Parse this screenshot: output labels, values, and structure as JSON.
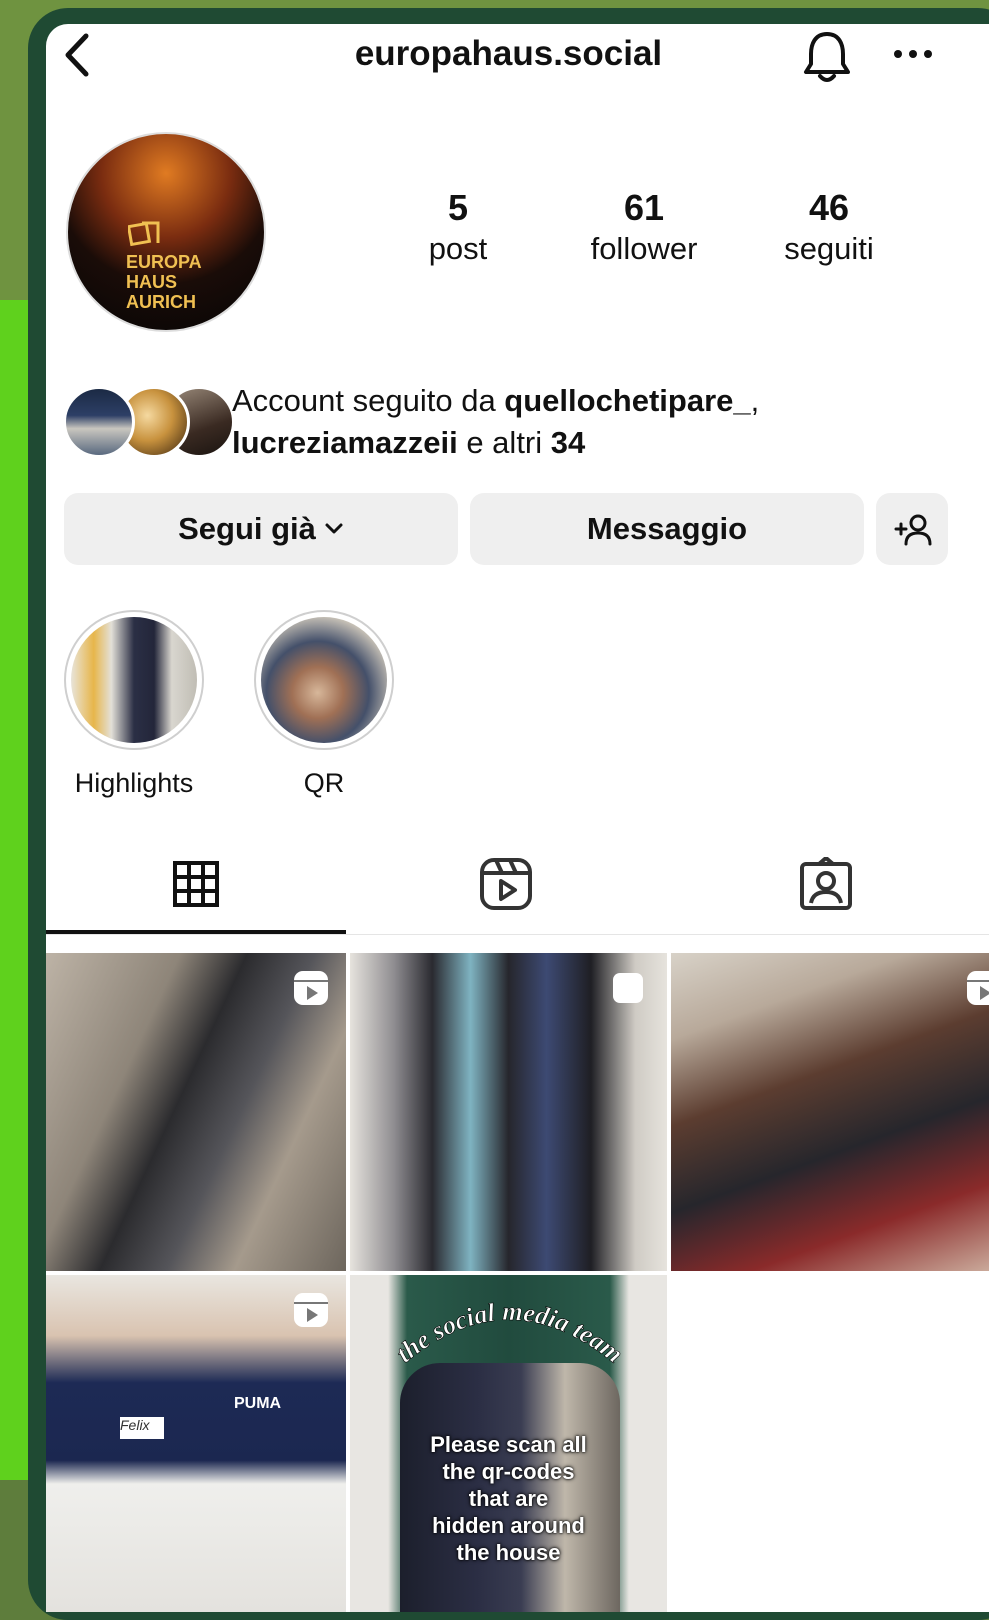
{
  "header": {
    "title": "europahaus.social"
  },
  "profile": {
    "avatar_logo_text": [
      "EUROPA",
      "HAUS",
      "AURICH"
    ],
    "stats": [
      {
        "value": "5",
        "label": "post"
      },
      {
        "value": "61",
        "label": "follower"
      },
      {
        "value": "46",
        "label": "seguiti"
      }
    ],
    "mutual": {
      "prefix": "Account seguito da ",
      "user1": "quellochetipare_",
      "sep": ",",
      "user2": "lucreziamazzeii",
      "middle": " e altri ",
      "count": "34"
    }
  },
  "actions": {
    "follow_label": "Segui già",
    "message_label": "Messaggio"
  },
  "highlights": [
    {
      "label": "Highlights"
    },
    {
      "label": "QR"
    }
  ],
  "tabs": [
    "grid",
    "reels",
    "tagged"
  ],
  "posts": {
    "overlay_arc": "the social media team",
    "overlay_lines": [
      "Please scan all",
      "the qr-codes",
      "that are",
      "hidden around",
      "the house"
    ],
    "hoodie_text": "PUMA",
    "tag_text": "Felix"
  },
  "colors": {
    "text": "#111111",
    "button_bg": "#efefef",
    "frame": "#1f4a33",
    "side_green": "#5fd11d"
  }
}
